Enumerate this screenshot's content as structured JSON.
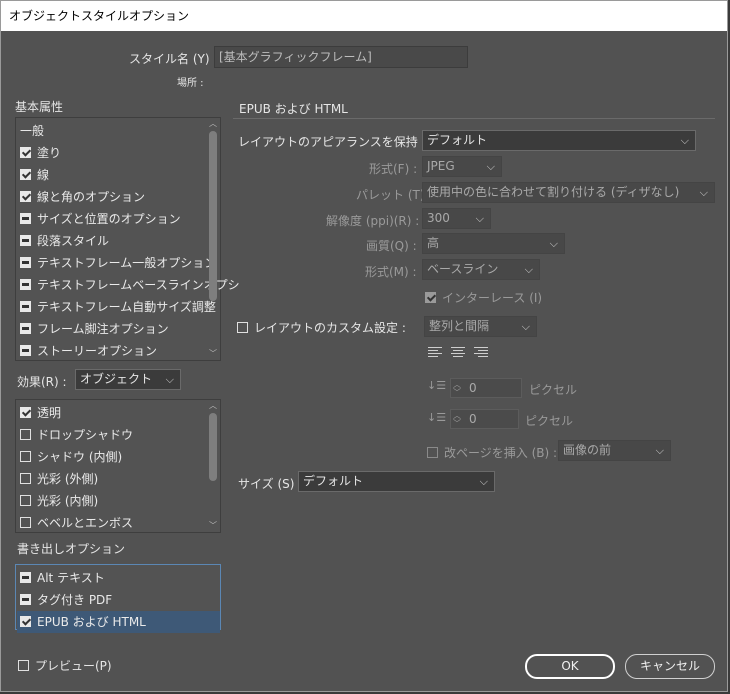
{
  "window": {
    "title": "オブジェクトスタイルオプション"
  },
  "style_name": {
    "label": "スタイル名 (Y) :",
    "value": "[基本グラフィックフレーム]"
  },
  "location": {
    "label": "場所 :"
  },
  "basic_attributes": {
    "heading": "基本属性",
    "items": [
      {
        "label": "一般",
        "state": "none"
      },
      {
        "label": "塗り",
        "state": "checked"
      },
      {
        "label": "線",
        "state": "checked"
      },
      {
        "label": "線と角のオプション",
        "state": "checked"
      },
      {
        "label": "サイズと位置のオプション",
        "state": "mixed"
      },
      {
        "label": "段落スタイル",
        "state": "mixed"
      },
      {
        "label": "テキストフレーム一般オプション",
        "state": "mixed"
      },
      {
        "label": "テキストフレームベースラインオプシ",
        "state": "mixed"
      },
      {
        "label": "テキストフレーム自動サイズ調整",
        "state": "mixed"
      },
      {
        "label": "フレーム脚注オプション",
        "state": "mixed"
      },
      {
        "label": "ストーリーオプション",
        "state": "mixed"
      }
    ]
  },
  "effects": {
    "label": "効果(R) :",
    "selected": "オブジェクト",
    "items": [
      {
        "label": "透明",
        "state": "checked"
      },
      {
        "label": "ドロップシャドウ",
        "state": "empty"
      },
      {
        "label": "シャドウ (内側)",
        "state": "empty"
      },
      {
        "label": "光彩 (外側)",
        "state": "empty"
      },
      {
        "label": "光彩 (内側)",
        "state": "empty"
      },
      {
        "label": "ベベルとエンボス",
        "state": "empty"
      }
    ]
  },
  "export_options": {
    "heading": "書き出しオプション",
    "items": [
      {
        "label": "Alt テキスト",
        "state": "mixed"
      },
      {
        "label": "タグ付き PDF",
        "state": "mixed"
      },
      {
        "label": "EPUB および HTML",
        "state": "checked"
      }
    ]
  },
  "epub": {
    "heading": "EPUB および HTML",
    "preserve_layout": {
      "label": "レイアウトのアピアランスを保持 (V) :",
      "value": "デフォルト"
    },
    "format": {
      "label": "形式(F) :",
      "value": "JPEG"
    },
    "palette": {
      "label": "パレット (T) :",
      "value": "使用中の色に合わせて割り付ける (ディザなし)"
    },
    "resolution": {
      "label": "解像度 (ppi)(R) :",
      "value": "300"
    },
    "quality": {
      "label": "画質(Q) :",
      "value": "高"
    },
    "method": {
      "label": "形式(M) :",
      "value": "ベースライン"
    },
    "interlace": {
      "label": "インターレース (I)"
    },
    "custom_layout": {
      "label": "レイアウトのカスタム設定 :",
      "value": "整列と間隔"
    },
    "spacing_before": {
      "value": "0",
      "unit": "ピクセル"
    },
    "spacing_after": {
      "value": "0",
      "unit": "ピクセル"
    },
    "page_break": {
      "label": "改ページを挿入 (B) :",
      "value": "画像の前"
    },
    "size": {
      "label": "サイズ (S) :",
      "value": "デフォルト"
    }
  },
  "footer": {
    "preview_label": "プレビュー(P)",
    "ok_label": "OK",
    "cancel_label": "キャンセル"
  }
}
